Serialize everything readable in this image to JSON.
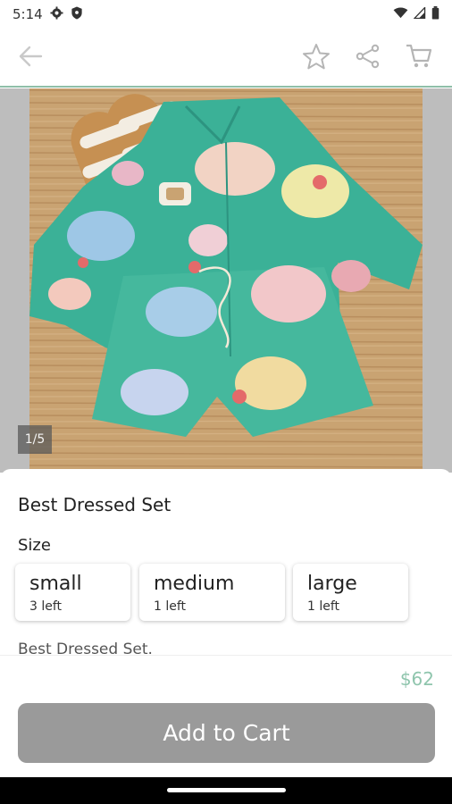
{
  "status_bar": {
    "time": "5:14"
  },
  "gallery": {
    "counter": "1/5"
  },
  "product": {
    "title": "Best Dressed Set",
    "size_heading": "Size",
    "sizes": [
      {
        "name": "small",
        "stock": "3 left"
      },
      {
        "name": "medium",
        "stock": "1 left"
      },
      {
        "name": "large",
        "stock": "1 left"
      }
    ],
    "description": "Best Dressed Set.",
    "price": "$62"
  },
  "actions": {
    "add_to_cart": "Add to Cart"
  },
  "icons": {
    "back": "arrow-left-icon",
    "favorite": "star-icon",
    "share": "share-icon",
    "cart": "cart-icon"
  },
  "colors": {
    "accent": "#8fc5ad",
    "button": "#9a9a9a"
  }
}
